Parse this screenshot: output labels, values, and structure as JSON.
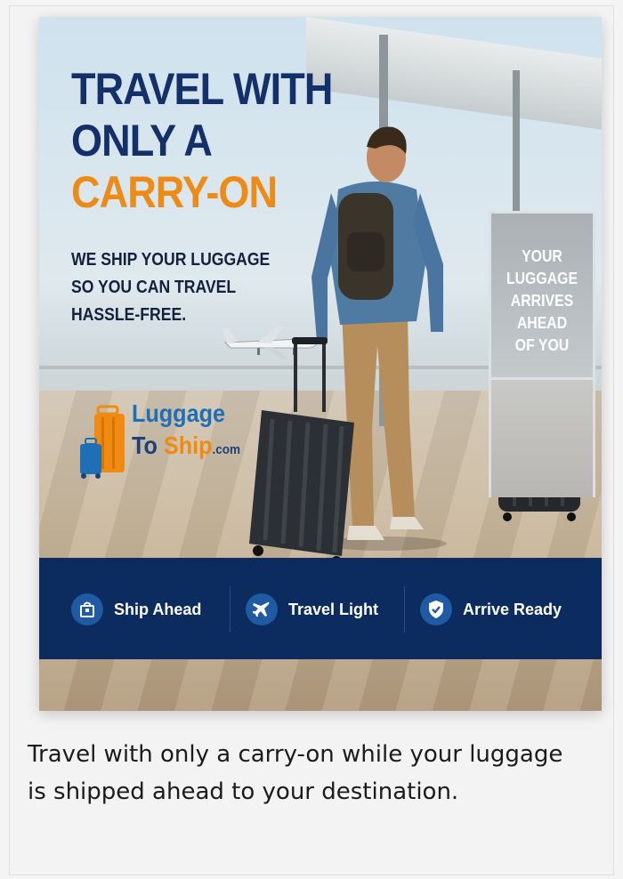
{
  "ad": {
    "headline": [
      "TRAVEL WITH",
      "ONLY A",
      "CARRY-ON"
    ],
    "subhead": [
      "WE SHIP YOUR LUGGAGE",
      "SO YOU CAN TRAVEL",
      "HASSLE-FREE."
    ],
    "logo": {
      "line1": "Luggage",
      "line2_prefix": "To ",
      "line2_highlight": "Ship",
      "line2_suffix": ".com"
    },
    "sign": [
      "YOUR",
      "LUGGAGE",
      "ARRIVES",
      "AHEAD",
      "OF YOU"
    ],
    "features": [
      {
        "icon": "shopping-bag-icon",
        "label": "Ship Ahead"
      },
      {
        "icon": "airplane-icon",
        "label": "Travel Light"
      },
      {
        "icon": "shield-check-icon",
        "label": "Arrive Ready"
      }
    ],
    "colors": {
      "navy": "#13306a",
      "orange": "#ee8a16",
      "banner": "#0c2b5e",
      "icon_bg": "#1f5aa3"
    }
  },
  "caption": "Travel with only a carry-on while your luggage is shipped ahead to your destination."
}
